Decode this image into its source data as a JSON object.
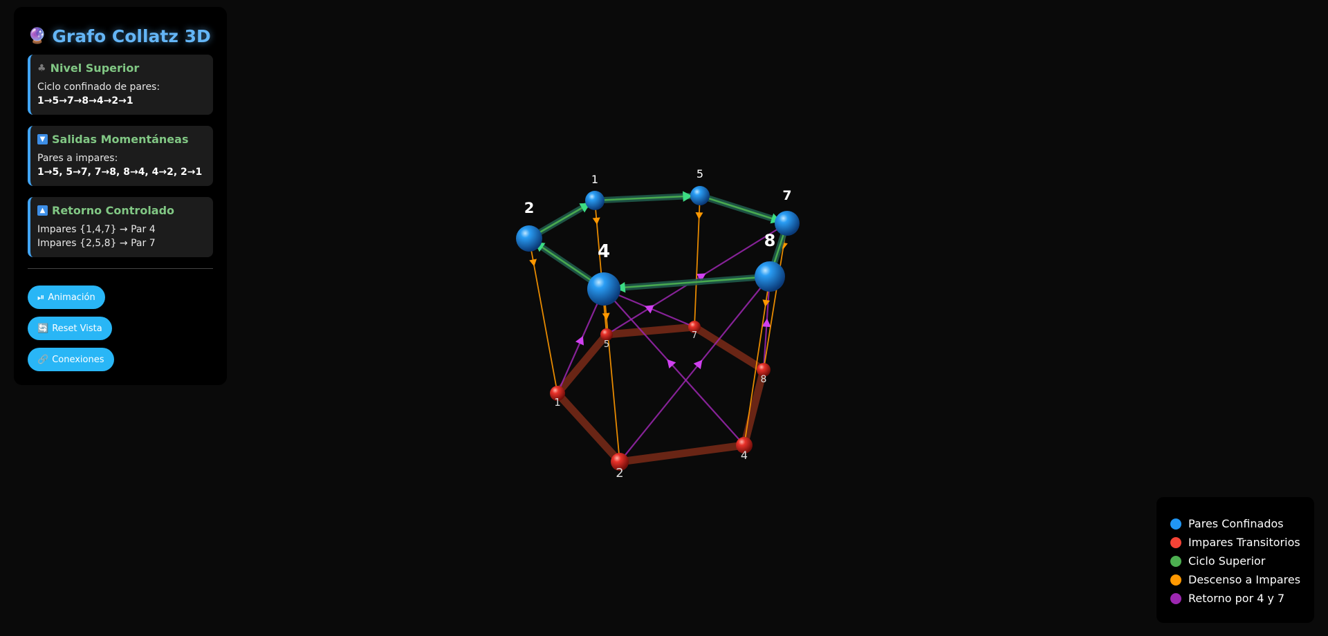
{
  "panel": {
    "title": "Grafo Collatz 3D",
    "title_icon": "crystal-ball-icon",
    "cards": [
      {
        "icon": "puzzle-icon",
        "heading": "Nivel Superior",
        "lines": [
          "Ciclo confinado de pares:",
          "1→5→7→8→4→2→1"
        ]
      },
      {
        "icon": "down-arrow-icon",
        "heading": "Salidas Momentáneas",
        "lines": [
          "Pares a impares:",
          "1→5, 5→7, 7→8, 8→4, 4→2, 2→1"
        ]
      },
      {
        "icon": "up-arrow-icon",
        "heading": "Retorno Controlado",
        "lines": [
          "Impares {1,4,7} → Par 4",
          "Impares {2,5,8} → Par 7"
        ]
      }
    ],
    "buttons": [
      {
        "label": "Animación",
        "icon": "play-pause-icon"
      },
      {
        "label": "Reset Vista",
        "icon": "refresh-icon"
      },
      {
        "label": "Conexiones",
        "icon": "link-icon"
      }
    ]
  },
  "legend": [
    {
      "label": "Pares Confinados",
      "color": "#2196f3"
    },
    {
      "label": "Impares Transitorios",
      "color": "#f44336"
    },
    {
      "label": "Ciclo Superior",
      "color": "#4caf50"
    },
    {
      "label": "Descenso a Impares",
      "color": "#ff9800"
    },
    {
      "label": "Retorno por 4 y 7",
      "color": "#9c27b0"
    }
  ],
  "graph": {
    "upper_nodes": [
      "1",
      "5",
      "7",
      "8",
      "4",
      "2"
    ],
    "lower_nodes": [
      "5",
      "7",
      "8",
      "4",
      "2",
      "1"
    ],
    "upper_cycle": [
      "1",
      "5",
      "7",
      "8",
      "4",
      "2"
    ],
    "descents": [
      [
        "1",
        "5"
      ],
      [
        "5",
        "7"
      ],
      [
        "7",
        "8"
      ],
      [
        "8",
        "4"
      ],
      [
        "4",
        "2"
      ],
      [
        "2",
        "1"
      ]
    ],
    "returns": [
      [
        "1",
        "4"
      ],
      [
        "4",
        "4"
      ],
      [
        "7",
        "4"
      ],
      [
        "2",
        "7"
      ],
      [
        "5",
        "7"
      ],
      [
        "8",
        "7"
      ]
    ]
  }
}
